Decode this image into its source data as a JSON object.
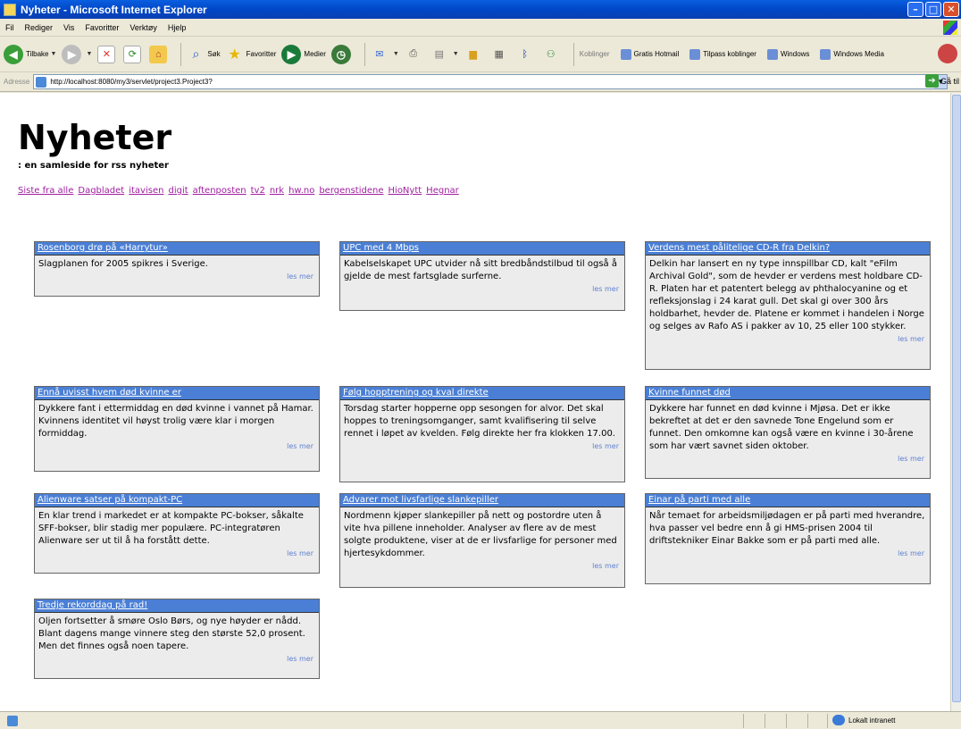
{
  "window": {
    "title": "Nyheter - Microsoft Internet Explorer"
  },
  "menu": [
    "Fil",
    "Rediger",
    "Vis",
    "Favoritter",
    "Verktøy",
    "Hjelp"
  ],
  "toolbar": {
    "back": "Tilbake",
    "search": "Søk",
    "favorites": "Favoritter",
    "media": "Medier",
    "links_label": "Koblinger",
    "links": [
      "Gratis Hotmail",
      "Tilpass koblinger",
      "Windows",
      "Windows Media"
    ]
  },
  "address": {
    "label": "Adresse",
    "url": "http://localhost:8080/my3/servlet/project3.Project3?",
    "go": "Gå til"
  },
  "page": {
    "title": "Nyheter",
    "tagline": ": en samleside for rss nyheter",
    "sources": [
      "Siste fra alle",
      "Dagbladet",
      "itavisen",
      "digit",
      "aftenposten",
      "tv2",
      "nrk",
      "hw.no",
      "bergenstidene",
      "HioNytt",
      "Hegnar"
    ],
    "more_label": "les mer",
    "articles": [
      {
        "title": "Rosenborg drø på «Harrytur»",
        "body": "Slagplanen for 2005 spikres i Sverige."
      },
      {
        "title": "UPC med 4 Mbps",
        "body": "Kabelselskapet UPC utvider nå sitt bredbåndstilbud til også å gjelde de mest fartsglade surferne."
      },
      {
        "title": "Verdens mest pålitelige CD-R fra Delkin?",
        "body": "Delkin har lansert en ny type innspillbar CD, kalt \"eFilm Archival Gold\", som de hevder er verdens mest holdbare CD-R. Platen har et patentert belegg av phthalocyanine og et refleksjonslag i 24 karat gull. Det skal gi over 300 års holdbarhet, hevder de. Platene er kommet i handelen i Norge og selges av Rafo AS i pakker av 10, 25 eller 100 stykker."
      },
      {
        "title": "Ennå uvisst hvem død kvinne er",
        "body": "Dykkere fant i ettermiddag en død kvinne i vannet på Hamar. Kvinnens identitet vil høyst trolig være klar i morgen formiddag."
      },
      {
        "title": "Følg hopptrening og kval direkte",
        "body": "Torsdag starter hopperne opp sesongen for alvor. Det skal hoppes to treningsomganger, samt kvalifisering til selve rennet i løpet av kvelden. Følg direkte her fra klokken 17.00."
      },
      {
        "title": "Kvinne funnet død",
        "body": "Dykkere har funnet en død kvinne i Mjøsa. Det er ikke bekreftet at det er den savnede Tone Engelund som er funnet. Den omkomne kan også være en kvinne i 30-årene som har vært savnet siden oktober."
      },
      {
        "title": "Alienware satser på kompakt-PC",
        "body": "En klar trend i markedet er at kompakte PC-bokser, såkalte SFF-bokser, blir stadig mer populære. PC-integratøren Alienware ser ut til å ha forstått dette."
      },
      {
        "title": "Advarer mot livsfarlige slankepiller",
        "body": "Nordmenn kjøper slankepiller på nett og postordre uten å vite hva pillene inneholder. Analyser av flere av de mest solgte produktene, viser at de er livsfarlige for personer med hjertesykdommer."
      },
      {
        "title": "Einar på parti med alle",
        "body": "Når temaet for arbeidsmiljødagen er på parti med hverandre, hva passer vel bedre enn å gi HMS-prisen 2004 til driftstekniker Einar Bakke som er på parti med alle."
      },
      {
        "title": "Tredje rekorddag på rad!",
        "body": "Oljen fortsetter å smøre Oslo Børs, og nye høyder er nådd. Blant dagens mange vinnere steg den største 52,0 prosent. Men det finnes også noen tapere."
      }
    ]
  },
  "status": {
    "zone": "Lokalt intranett"
  }
}
